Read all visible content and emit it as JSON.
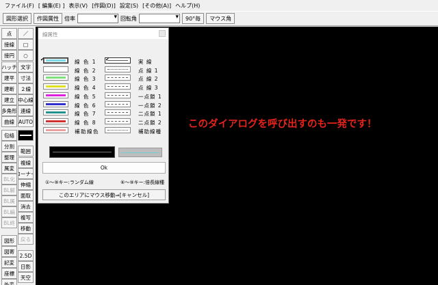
{
  "menu": [
    "ファイル(F)",
    "[ 編集(E) ]",
    "表示(V)",
    "[作図(D)]",
    "設定(S)",
    "[その他(A)]",
    "ヘルプ(H)"
  ],
  "toolbar": {
    "shape_select": "図形選択",
    "attr": "作図属性",
    "angle_label1": "倍率",
    "angle_label2": "回転角",
    "deg90": "90°毎",
    "mouse_angle": "マウス角"
  },
  "palette": {
    "left": [
      "点",
      "接線",
      "接円",
      "ハッチ",
      "建平",
      "建断",
      "建立",
      "多角形",
      "曲線",
      "包絡",
      "分割",
      "整理",
      "属変",
      "BL化",
      "BL解",
      "BL属",
      "BL編",
      "BL終",
      "図形",
      "図寄",
      "記変",
      "座標",
      "外変"
    ],
    "right": [
      "／",
      "□",
      "○",
      "文字",
      "寸法",
      "２線",
      "中心線",
      "連線",
      "AUTO",
      "",
      "範囲",
      "複線",
      "コーナー",
      "伸縮",
      "面取",
      "消去",
      "複写",
      "移動",
      "戻る",
      "2.5D",
      "日影",
      "天空"
    ]
  },
  "dialog": {
    "title": "線属性",
    "colors": [
      {
        "label": "線 色 1",
        "color": "#7fd8e8"
      },
      {
        "label": "線 色 2",
        "color": "#ffffff"
      },
      {
        "label": "線 色 3",
        "color": "#7ee07e"
      },
      {
        "label": "線 色 4",
        "color": "#e0e020"
      },
      {
        "label": "線 色 5",
        "color": "#e020e0"
      },
      {
        "label": "線 色 6",
        "color": "#3030d0"
      },
      {
        "label": "線 色 7",
        "color": "#209090"
      },
      {
        "label": "線 色 8",
        "color": "#d03030"
      },
      {
        "label": "補助線色",
        "color": "#e8a0a0"
      }
    ],
    "linetypes": [
      "実 線",
      "点 線 1",
      "点 線 2",
      "点 線 3",
      "一点鎖 1",
      "一点鎖 2",
      "二点鎖 1",
      "二点鎖 2",
      "補助線種"
    ],
    "ok": "Ok",
    "hint_left": "①～⑨キー:ランダム線",
    "hint_right": "⑥～⑨キー:倍長線種",
    "area": "このエリアにマウス移動⇒[キャンセル]"
  },
  "message": "このダイアログを呼び出すのも一発です！"
}
